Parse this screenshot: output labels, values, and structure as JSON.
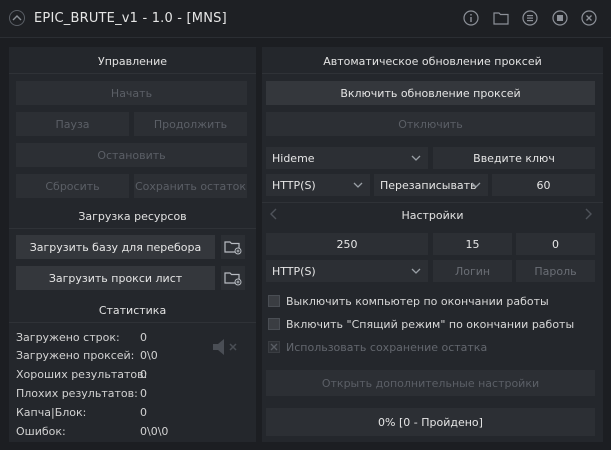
{
  "window": {
    "title": "EPIC_BRUTE_v1 - 1.0 - [MNS]"
  },
  "icons": {
    "titlebar": [
      "info-icon",
      "folder-icon",
      "list-icon",
      "stop-icon",
      "close-icon"
    ],
    "sound": "speaker-muted-icon"
  },
  "control": {
    "heading": "Управление",
    "start": "Начать",
    "pause": "Пауза",
    "resume": "Продолжить",
    "stop": "Остановить",
    "reset": "Сбросить",
    "save_rest": "Сохранить остаток"
  },
  "resources": {
    "heading": "Загрузка ресурсов",
    "load_base": "Загрузить базу для перебора",
    "load_proxy": "Загрузить прокси лист"
  },
  "stats": {
    "heading": "Статистика",
    "rows": [
      {
        "label": "Загружено строк:",
        "value": "0"
      },
      {
        "label": "Загружено проксей:",
        "value": "0\\0"
      },
      {
        "label": "Хороших результатов:",
        "value": "0"
      },
      {
        "label": "Плохих результатов:",
        "value": "0"
      },
      {
        "label": "Капча|Блок:",
        "value": "0"
      },
      {
        "label": "Ошибок:",
        "value": "0\\0\\0"
      }
    ]
  },
  "proxy_update": {
    "heading": "Автоматическое обновление проксей",
    "enable": "Включить обновление проксей",
    "disable": "Отключить",
    "source": "Hideme",
    "enter_key": "Введите ключ",
    "proto": "HTTP(S)",
    "mode": "Перезаписывать",
    "interval": "60"
  },
  "settings": {
    "heading": "Настройки",
    "threads": "250",
    "timeout": "15",
    "retries": "0",
    "proto": "HTTP(S)",
    "login": "Логин",
    "password": "Пароль",
    "opt_shutdown": "Выключить компьютер по окончании работы",
    "opt_sleep": "Включить \"Спящий режим\" по окончании работы",
    "opt_save_rest": "Использовать сохранение остатка",
    "more_settings": "Открыть дополнительные настройки"
  },
  "progress": {
    "text": "0% [0 - Пройдено]",
    "percent": 0
  },
  "colors": {
    "background": "#1c1e22",
    "panel": "#24272c",
    "button": "#2c2f34",
    "text": "#e6e6e6",
    "dim_text": "#5b5f66"
  }
}
